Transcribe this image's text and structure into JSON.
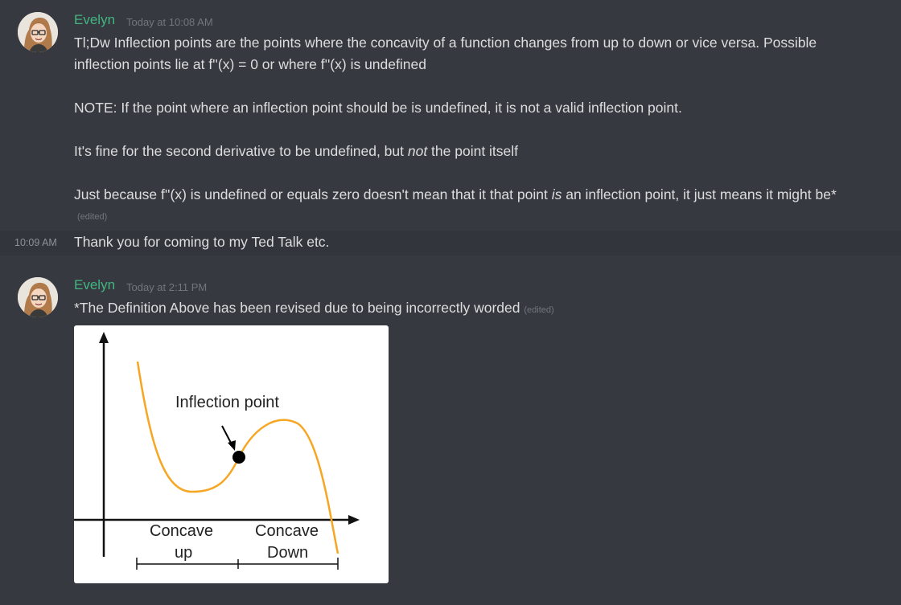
{
  "messages": [
    {
      "author": "Evelyn",
      "timestamp": "Today at 10:08 AM",
      "lines": [
        "Tl;Dw Inflection points are the points where the concavity of a function changes from up to down or vice versa. Possible",
        "inflection points lie at f''(x) = 0 or where f''(x) is undefined",
        "NOTE: If the point where an inflection point should be is undefined, it is not a valid inflection point.",
        "It's fine for the second derivative to be undefined, but ",
        "not",
        " the point itself",
        "Just because f''(x) is undefined or equals zero doesn't mean that it that point ",
        "is",
        " an inflection point, it just means it might be*"
      ],
      "edited_label": "(edited)"
    },
    {
      "side_time": "10:09 AM",
      "text": "Thank you for coming to my Ted Talk etc."
    },
    {
      "author": "Evelyn",
      "timestamp": "Today at 2:11 PM",
      "text": "*The Definition Above has been revised due to being incorrectly worded",
      "edited_label": "(edited)",
      "attachment": {
        "label_inflection": "Inflection point",
        "label_concave_up_1": "Concave",
        "label_concave_up_2": "up",
        "label_concave_down_1": "Concave",
        "label_concave_down_2": "Down",
        "curve_color": "#f6a623"
      }
    }
  ],
  "colors": {
    "background": "#36393f",
    "username": "#43b581",
    "text": "#dcddde",
    "muted": "#72767d"
  }
}
